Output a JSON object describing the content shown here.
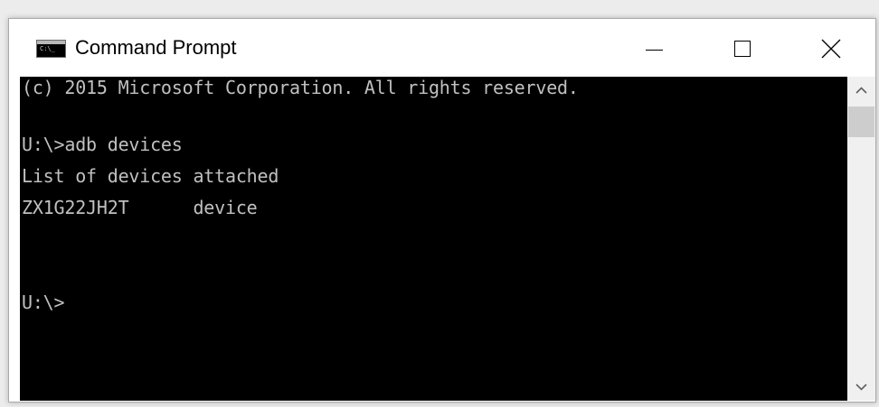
{
  "window": {
    "title": "Command Prompt",
    "icon": "cmd-icon",
    "controls": [
      "minimize-icon",
      "maximize-icon",
      "close-icon"
    ]
  },
  "console": {
    "lines": [
      "(c) 2015 Microsoft Corporation. All rights reserved.",
      "",
      "U:\\>adb devices",
      "List of devices attached",
      "ZX1G22JH2T      device",
      "",
      "",
      "U:\\>"
    ],
    "text_color": "#c0c0c0",
    "background_color": "#000000"
  },
  "scrollbar": {
    "up_icon": "chevron-up-icon",
    "down_icon": "chevron-down-icon"
  }
}
